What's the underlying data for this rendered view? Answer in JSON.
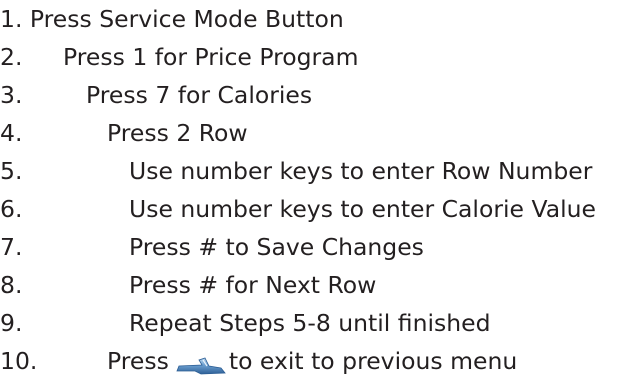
{
  "steps": [
    {
      "text": "1. Press Service Mode Button"
    },
    {
      "num": "2.",
      "text": "Press 1 for Price Program"
    },
    {
      "num": "3.",
      "text": "Press 7 for Calories"
    },
    {
      "num": "4.",
      "text": "Press 2 Row"
    },
    {
      "num": "5.",
      "text": "Use number keys to enter Row Number"
    },
    {
      "num": "6.",
      "text": "Use number keys to enter Calorie Value"
    },
    {
      "num": "7.",
      "text": "Press # to Save Changes"
    },
    {
      "num": "8.",
      "text": "Press # for Next Row"
    },
    {
      "num": "9.",
      "text": "Repeat Steps 5-8 until finished"
    },
    {
      "num": "10.",
      "text_before": "Press",
      "icon": "back-arrow-key-icon",
      "text_after": "to exit to previous menu"
    }
  ]
}
